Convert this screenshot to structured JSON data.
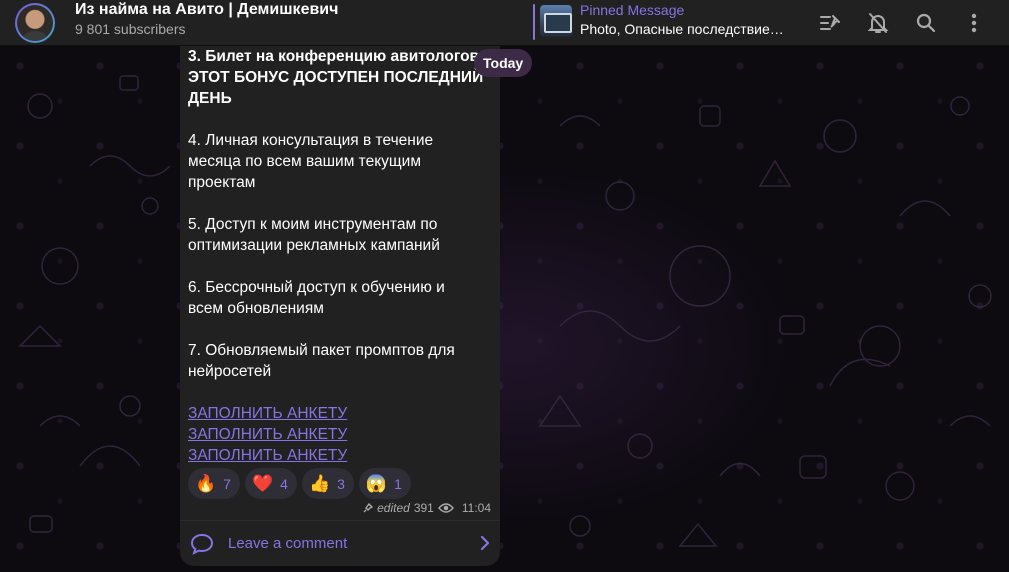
{
  "header": {
    "channel_title": "Из найма на Авито | Демишкевич",
    "subscribers": "9 801 subscribers",
    "pinned": {
      "title": "Pinned Message",
      "text": "Photo, Опасные последствие…"
    },
    "icons": [
      "pinned-list-icon",
      "mute-bell-icon",
      "search-icon",
      "more-vertical-icon"
    ]
  },
  "date_badge": "Today",
  "message": {
    "lines": [
      {
        "text": "3. Билет на конференцию авитологов –",
        "bold": true
      },
      {
        "text": "ЭТОТ БОНУС ДОСТУПЕН ПОСЛЕДНИЙ",
        "bold": true
      },
      {
        "text": "ДЕНЬ",
        "bold": true
      },
      {
        "text": "",
        "bold": false
      },
      {
        "text": "4. Личная консультация в течение",
        "bold": false
      },
      {
        "text": "месяца по всем вашим текущим",
        "bold": false
      },
      {
        "text": "проектам",
        "bold": false
      },
      {
        "text": "",
        "bold": false
      },
      {
        "text": "5. Доступ к моим инструментам по",
        "bold": false
      },
      {
        "text": "оптимизации рекламных кампаний",
        "bold": false
      },
      {
        "text": "",
        "bold": false
      },
      {
        "text": "6. Бессрочный доступ к обучению и",
        "bold": false
      },
      {
        "text": "всем обновлениям",
        "bold": false
      },
      {
        "text": "",
        "bold": false
      },
      {
        "text": "7. Обновляемый пакет промптов для",
        "bold": false
      },
      {
        "text": "нейросетей",
        "bold": false
      },
      {
        "text": "",
        "bold": false
      }
    ],
    "links": [
      "ЗАПОЛНИТЬ АНКЕТУ",
      "ЗАПОЛНИТЬ АНКЕТУ",
      "ЗАПОЛНИТЬ АНКЕТУ"
    ],
    "reactions": [
      {
        "emoji": "🔥",
        "count": "7"
      },
      {
        "emoji": "❤️",
        "count": "4"
      },
      {
        "emoji": "👍",
        "count": "3"
      },
      {
        "emoji": "😱",
        "count": "1"
      }
    ],
    "edited": "edited",
    "views": "391",
    "time": "11:04",
    "comment_label": "Leave a comment"
  },
  "colors": {
    "accent": "#8774e1",
    "header_bg": "#212121",
    "bubble_bg": "#212121",
    "badge_bg": "#3d2a47"
  }
}
